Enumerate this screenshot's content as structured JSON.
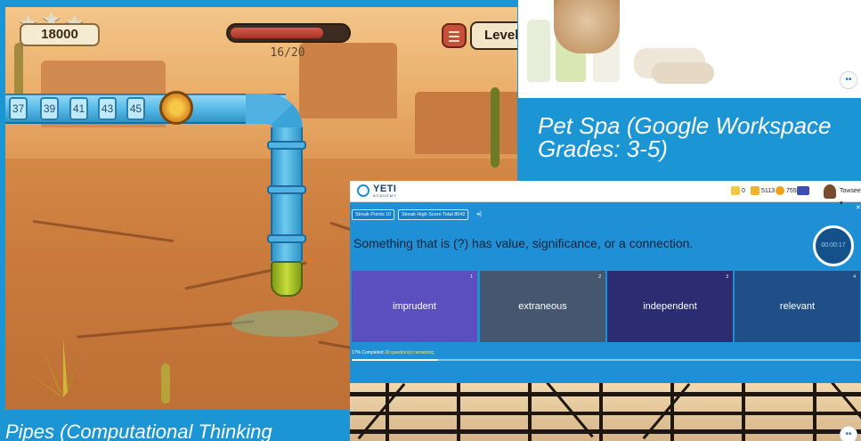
{
  "game": {
    "score": "18000",
    "star_icons": [
      "star-icon",
      "star-icon",
      "star-icon"
    ],
    "progress": {
      "label": "16/20",
      "fraction": 0.8
    },
    "menu_icon": "hamburger-menu-icon",
    "level_label": "Level:",
    "pipe_numbers": [
      "37",
      "39",
      "41",
      "43",
      "45"
    ]
  },
  "cards": {
    "pet_spa_title": "Pet Spa (Google Workspace Grades: 3-5)",
    "pipes_title": "Pipes (Computational Thinking"
  },
  "quiz": {
    "logo": {
      "name": "YETI",
      "sub": "ACADEMY"
    },
    "stats": {
      "badge_count": "0",
      "points": "5113",
      "coins": "755",
      "user_name": "Towsee"
    },
    "chips": {
      "streak_points": "Streak Points 10",
      "high_score": "Streak High Score Total 8542"
    },
    "question": "Something that is (?) has value, significance, or a connection.",
    "timer": "00:00:17",
    "options": [
      {
        "num": "1",
        "text": "imprudent",
        "color": "#5b4fc0"
      },
      {
        "num": "2",
        "text": "extraneous",
        "color": "#44576e"
      },
      {
        "num": "3",
        "text": "independent",
        "color": "#2b2c72"
      },
      {
        "num": "4",
        "text": "relevant",
        "color": "#1f4f86"
      }
    ],
    "status": {
      "percent": "17% Completed",
      "remaining": "30 question(s) remaining",
      "fraction": 0.17
    },
    "close_icon": "close-icon",
    "speaker_icon": "speaker-icon"
  },
  "colors": {
    "background": "#1b95d4",
    "quiz_panel": "#1f8fd6"
  }
}
